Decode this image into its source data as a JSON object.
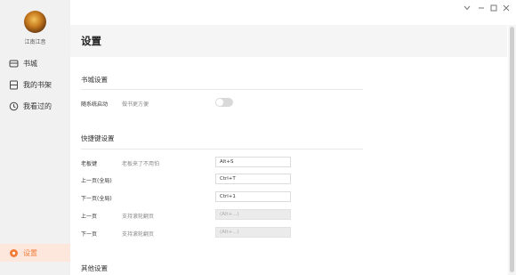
{
  "user": {
    "name": "江南江音"
  },
  "sidebar": {
    "items": [
      {
        "label": "书城",
        "icon": "bookstore-icon"
      },
      {
        "label": "我的书架",
        "icon": "bookshelf-icon"
      },
      {
        "label": "我看过的",
        "icon": "history-icon"
      }
    ],
    "settings": {
      "label": "设置",
      "icon": "settings-icon"
    }
  },
  "window_controls": [
    "chevron-down-icon",
    "minimize-icon",
    "maximize-icon",
    "close-icon"
  ],
  "page": {
    "title": "设置"
  },
  "sections": {
    "bookstore": {
      "title": "书城设置",
      "rows": [
        {
          "label": "随系统启动",
          "desc": "做书更方便",
          "toggle_on": false
        }
      ]
    },
    "shortcuts": {
      "title": "快捷键设置",
      "rows": [
        {
          "label": "老板键",
          "desc": "老板来了不用怕",
          "value": "Alt+S"
        },
        {
          "label": "上一页(全局)",
          "desc": "",
          "value": "Ctrl+T"
        },
        {
          "label": "下一页(全局)",
          "desc": "",
          "value": "Ctrl+1"
        },
        {
          "label": "上一页",
          "desc": "支持滚轮翻页",
          "value": "(Alt+...)"
        },
        {
          "label": "下一页",
          "desc": "支持滚轮翻页",
          "value": "(Alt+...)"
        }
      ]
    },
    "other": {
      "title": "其他设置"
    }
  },
  "colors": {
    "accent": "#f07c38",
    "sidebar_bg": "#f1f1f1",
    "active_bg": "#fde7dd"
  }
}
